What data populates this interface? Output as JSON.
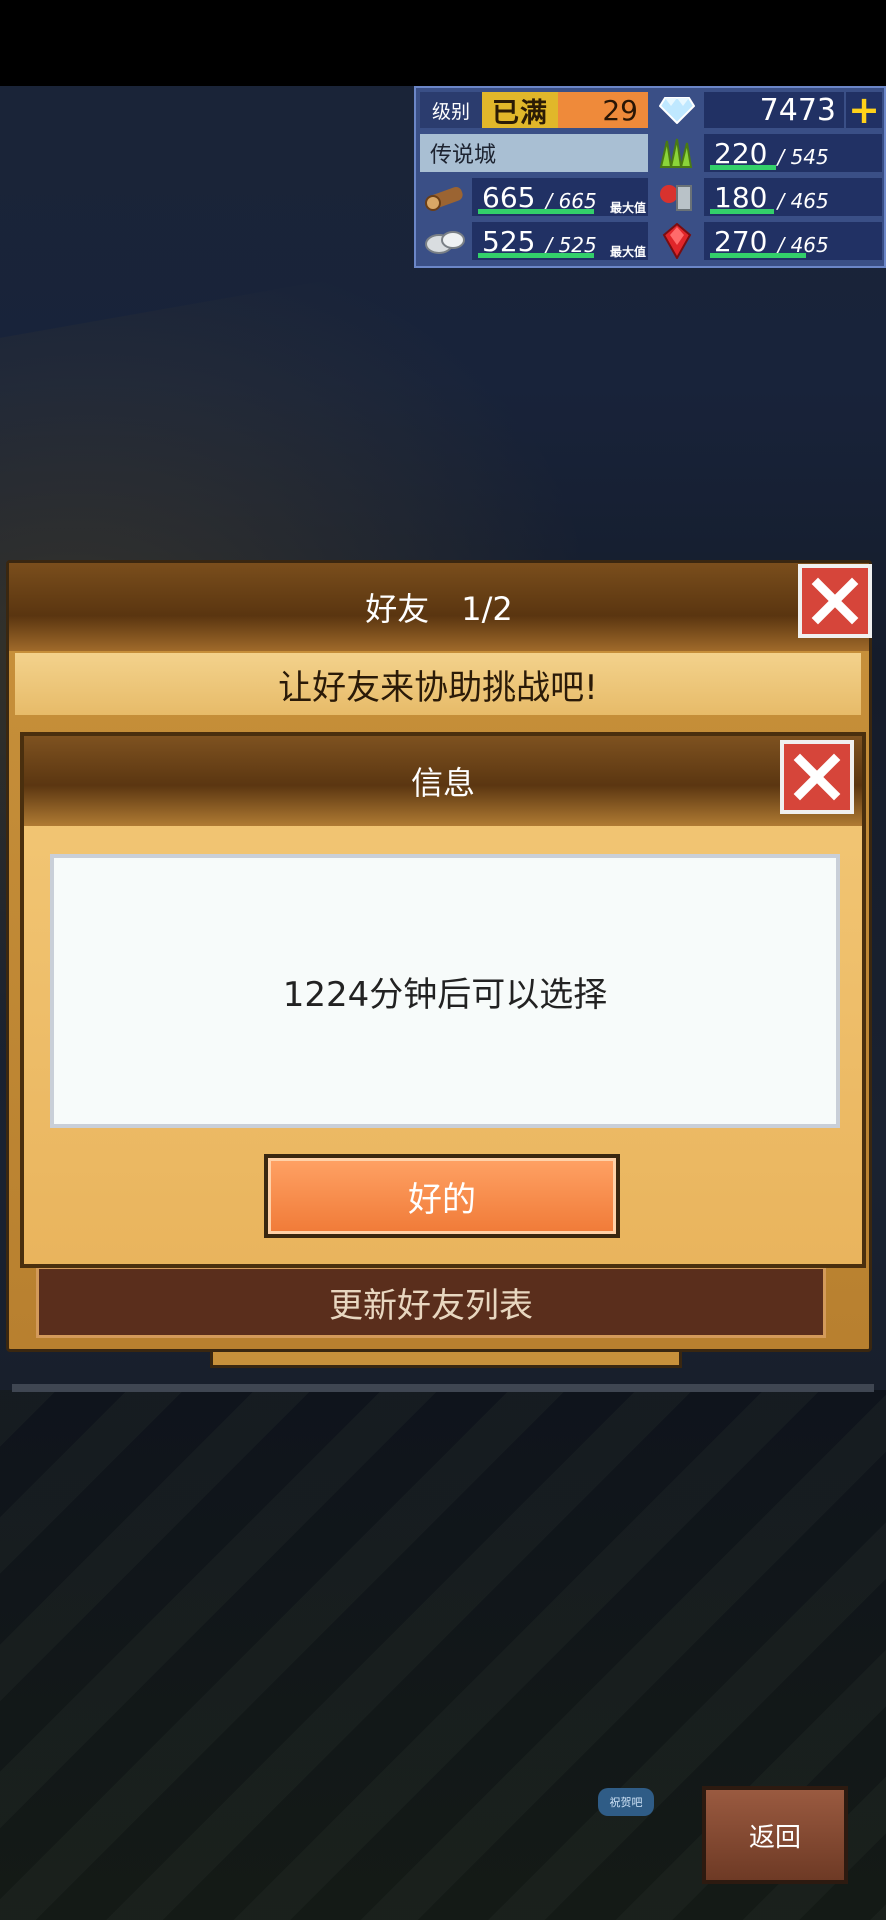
{
  "hud": {
    "level_label": "级别",
    "level_status": "已满",
    "level_value": "29",
    "gems": "7473",
    "town_name": "传说城",
    "resources": [
      {
        "icon": "wood-icon",
        "value": "665",
        "max": "665",
        "max_tag": "最大值",
        "fill": 1.0
      },
      {
        "icon": "grass-icon",
        "value": "220",
        "max": "545",
        "fill": 0.4
      },
      {
        "icon": "food-icon",
        "value": "180",
        "max": "465",
        "fill": 0.39
      },
      {
        "icon": "stone-icon",
        "value": "525",
        "max": "525",
        "max_tag": "最大值",
        "fill": 1.0
      },
      {
        "icon": "ruby-icon",
        "value": "270",
        "max": "465",
        "fill": 0.58
      }
    ]
  },
  "friends_panel": {
    "title": "好友　1/2",
    "subtitle": "让好友来协助挑战吧!",
    "refresh_label": "更新好友列表"
  },
  "info_dialog": {
    "title": "信息",
    "message": "1224分钟后可以选择",
    "ok_label": "好的"
  },
  "footer": {
    "back_label": "返回",
    "chat_label": "祝贺吧"
  },
  "colors": {
    "close_red": "#d6453a",
    "ok_orange": "#f07a37",
    "hud_blue": "#3a4f86"
  }
}
